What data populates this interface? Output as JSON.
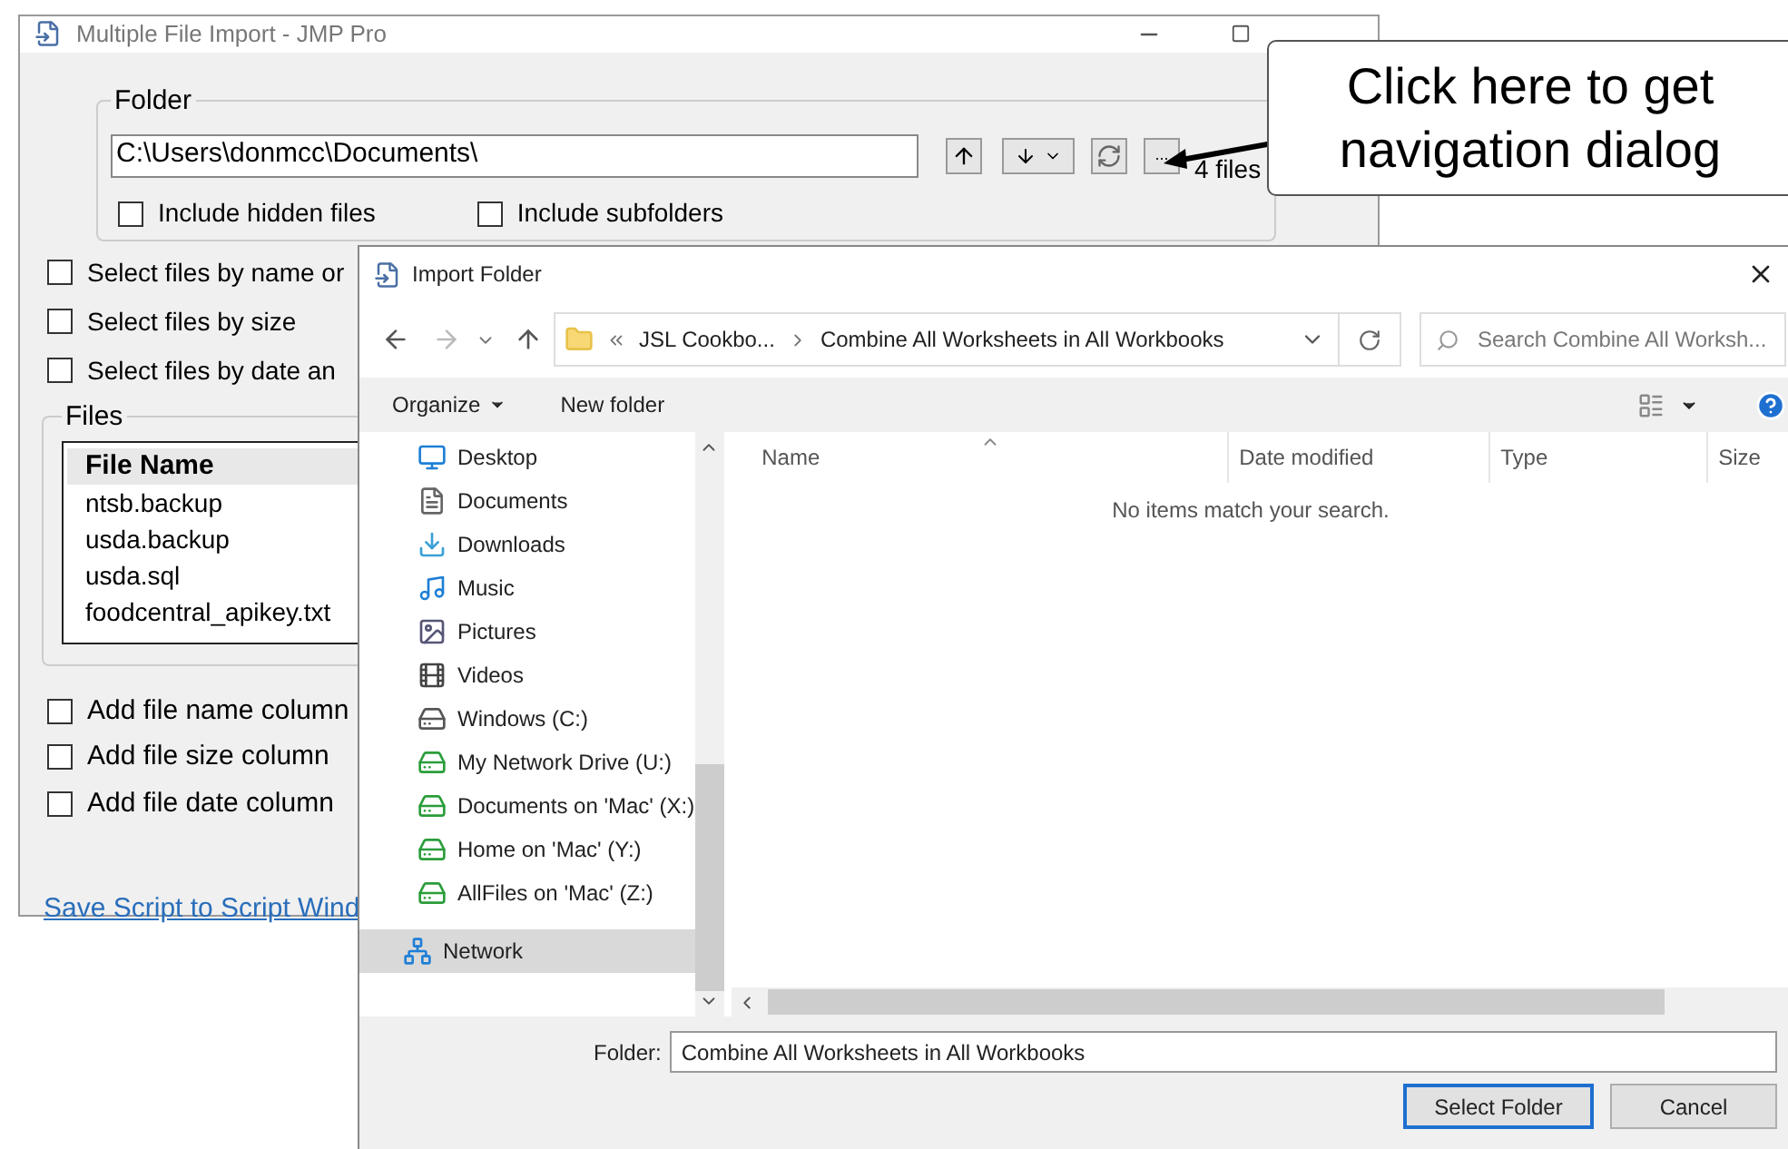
{
  "main_window": {
    "title": "Multiple File Import - JMP Pro",
    "folder_group": {
      "label": "Folder",
      "path": "C:\\Users\\donmcc\\Documents\\",
      "browse_button": "...",
      "file_count": "4 files",
      "options": [
        {
          "label": "Include hidden files",
          "checked": false
        },
        {
          "label": "Include subfolders",
          "checked": false
        }
      ]
    },
    "filters": [
      {
        "label": "Select files by name or",
        "checked": false
      },
      {
        "label": "Select files by size",
        "checked": false
      },
      {
        "label": "Select files by date an",
        "checked": false
      }
    ],
    "files_group": {
      "label": "Files",
      "column": "File Name",
      "rows": [
        "ntsb.backup",
        "usda.backup",
        "usda.sql",
        "foodcentral_apikey.txt"
      ]
    },
    "column_options": [
      {
        "label": "Add file name column",
        "checked": false
      },
      {
        "label": "Add file size column",
        "checked": false
      },
      {
        "label": "Add file date column",
        "checked": false
      }
    ],
    "link": "Save Script to Script Wind"
  },
  "dialog": {
    "title": "Import Folder",
    "address": {
      "parent": "JSL Cookbo...",
      "current": "Combine All Worksheets in All Workbooks"
    },
    "search": {
      "placeholder": "Search Combine All Worksh..."
    },
    "toolbar": {
      "organize": "Organize",
      "new_folder": "New folder"
    },
    "nav": {
      "items": [
        {
          "label": "Desktop",
          "kind": "desktop",
          "selected": false
        },
        {
          "label": "Documents",
          "kind": "documents",
          "selected": false
        },
        {
          "label": "Downloads",
          "kind": "downloads",
          "selected": false
        },
        {
          "label": "Music",
          "kind": "music",
          "selected": false
        },
        {
          "label": "Pictures",
          "kind": "pictures",
          "selected": false
        },
        {
          "label": "Videos",
          "kind": "videos",
          "selected": false
        },
        {
          "label": "Windows (C:)",
          "kind": "drive",
          "selected": false
        },
        {
          "label": "My Network Drive (U:)",
          "kind": "network_drive",
          "selected": false
        },
        {
          "label": "Documents on 'Mac' (X:)",
          "kind": "network_drive",
          "selected": false
        },
        {
          "label": "Home on 'Mac' (Y:)",
          "kind": "network_drive",
          "selected": false
        },
        {
          "label": "AllFiles on 'Mac' (Z:)",
          "kind": "network_drive",
          "selected": false
        }
      ],
      "root_items": [
        {
          "label": "Network",
          "kind": "network",
          "selected": true
        }
      ]
    },
    "columns": [
      "Name",
      "Date modified",
      "Type",
      "Size"
    ],
    "empty_message": "No items match your search.",
    "folder_label": "Folder:",
    "folder_value": "Combine All Worksheets in All Workbooks",
    "buttons": [
      {
        "label": "Select Folder",
        "kind": "default"
      },
      {
        "label": "Cancel",
        "kind": "normal"
      }
    ]
  },
  "callout": {
    "text": "Click here to get navigation dialog"
  }
}
